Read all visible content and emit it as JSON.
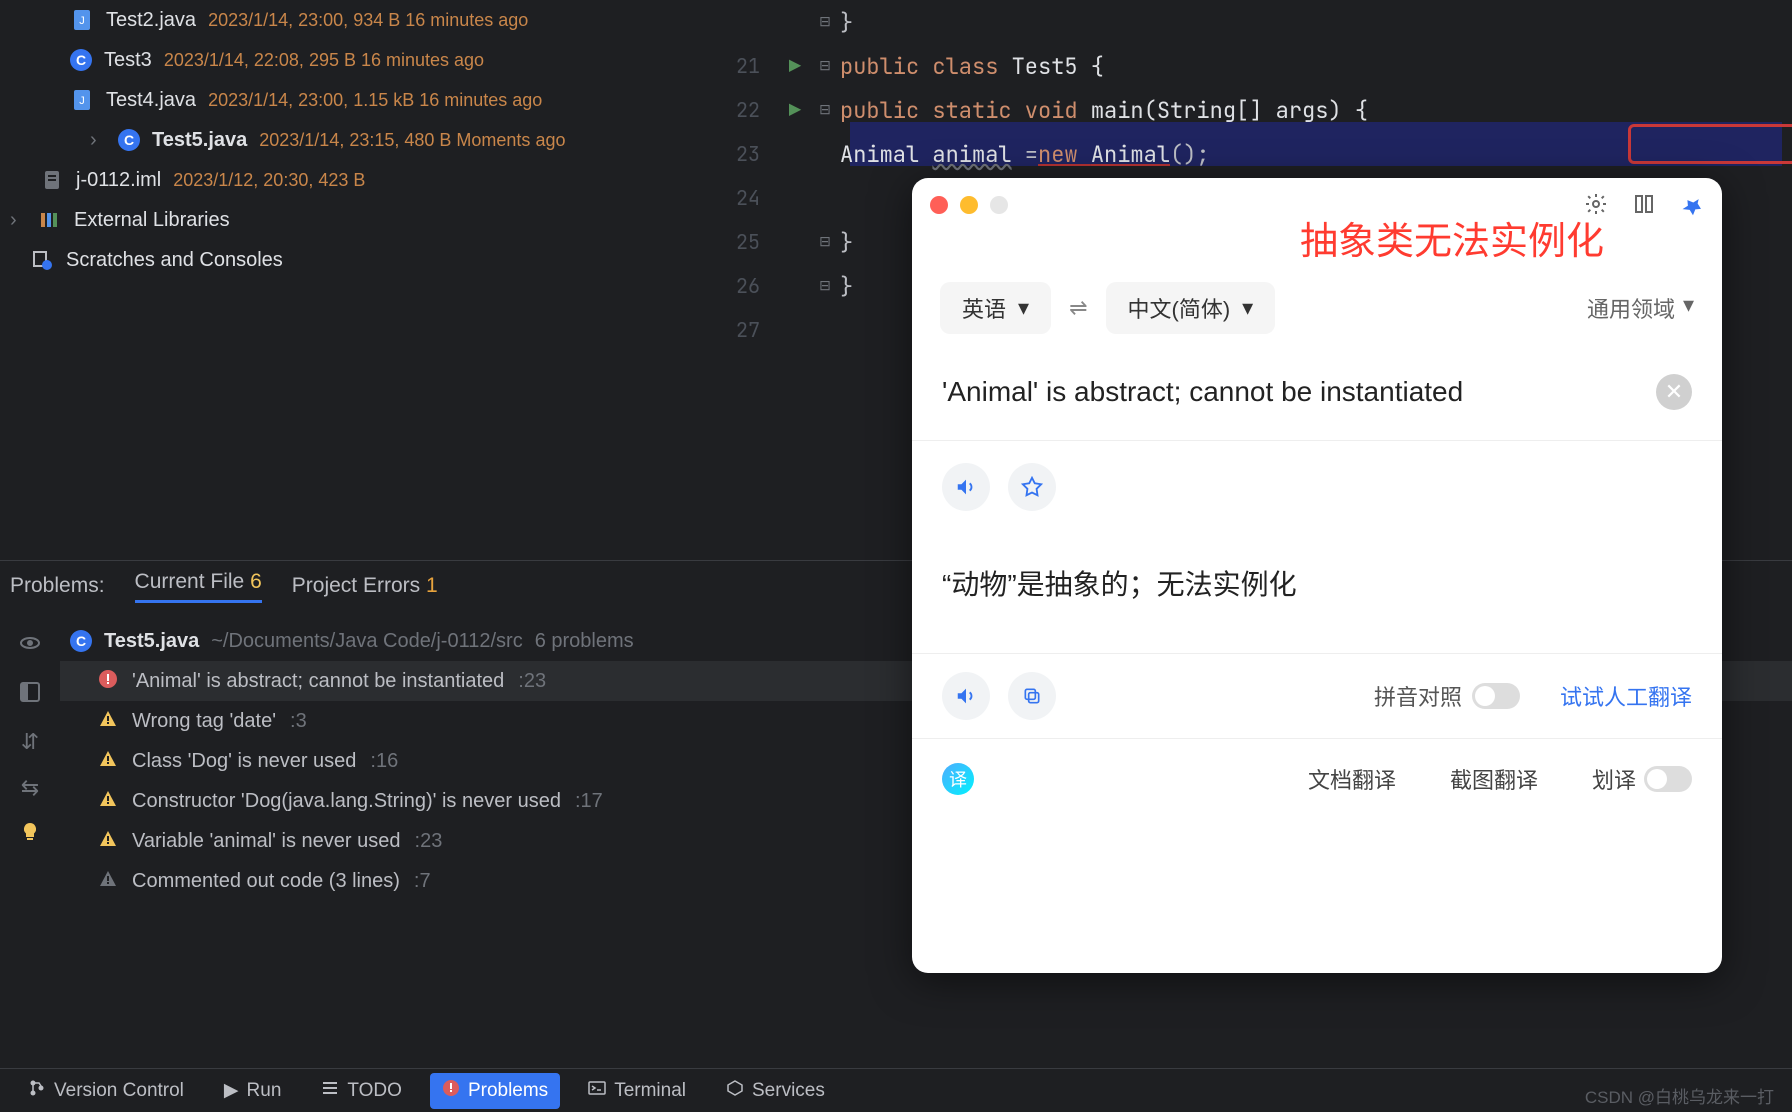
{
  "tree": {
    "files": [
      {
        "icon": "java",
        "name": "Test2.java",
        "meta": "2023/1/14, 23:00, 934 B 16 minutes ago"
      },
      {
        "icon": "class",
        "name": "Test3",
        "meta": "2023/1/14, 22:08, 295 B 16 minutes ago"
      },
      {
        "icon": "java",
        "name": "Test4.java",
        "meta": "2023/1/14, 23:00, 1.15 kB 16 minutes ago"
      },
      {
        "icon": "class",
        "name": "Test5.java",
        "meta": "2023/1/14, 23:15, 480 B Moments ago",
        "expandable": true
      },
      {
        "icon": "iml",
        "name": "j-0112.iml",
        "meta": "2023/1/12, 20:30, 423 B",
        "level": 1
      }
    ],
    "external_libs": "External Libraries",
    "scratches": "Scratches and Consoles"
  },
  "editor": {
    "lines": [
      {
        "num": "",
        "fold": "⊟",
        "tokens": [
          {
            "t": "}",
            "c": ""
          }
        ]
      },
      {
        "num": "21",
        "run": "▶",
        "fold": "⊟",
        "tokens": [
          {
            "t": "public class ",
            "c": "kw"
          },
          {
            "t": "Test5 {",
            "c": "typ"
          }
        ]
      },
      {
        "num": "22",
        "run": "▶",
        "fold": "⊟",
        "tokens": [
          {
            "t": "    public static void ",
            "c": "kw"
          },
          {
            "t": "main",
            "c": "typ"
          },
          {
            "t": "(String[] args) {",
            "c": "typ"
          }
        ]
      },
      {
        "num": "23",
        "fold": "",
        "tokens": [
          {
            "t": "        Animal ",
            "c": "typ"
          },
          {
            "t": "animal",
            "c": "var wiggle"
          },
          {
            "t": " =",
            "c": ""
          },
          {
            "t": "new ",
            "c": "kw underline-err"
          },
          {
            "t": "Animal",
            "c": "typ underline-err"
          },
          {
            "t": "();",
            "c": ""
          }
        ]
      },
      {
        "num": "24",
        "fold": "",
        "tokens": []
      },
      {
        "num": "25",
        "fold": "⊟",
        "tokens": [
          {
            "t": "    }",
            "c": ""
          }
        ]
      },
      {
        "num": "26",
        "fold": "⊟",
        "tokens": [
          {
            "t": "}",
            "c": ""
          }
        ]
      },
      {
        "num": "27",
        "fold": "",
        "tokens": []
      }
    ]
  },
  "cn_overlay": "抽象类无法实例化",
  "problems": {
    "label": "Problems:",
    "tabs": {
      "current": {
        "label": "Current File",
        "count": "6"
      },
      "project": {
        "label": "Project Errors",
        "count": "1"
      }
    },
    "header": {
      "file": "Test5.java",
      "path": "~/Documents/Java Code/j-0112/src",
      "count": "6 problems"
    },
    "items": [
      {
        "sev": "err",
        "text": "'Animal' is abstract; cannot be instantiated",
        "loc": ":23",
        "selected": true
      },
      {
        "sev": "warn",
        "text": "Wrong tag 'date'",
        "loc": ":3"
      },
      {
        "sev": "warn",
        "text": "Class 'Dog' is never used",
        "loc": ":16"
      },
      {
        "sev": "warn",
        "text": "Constructor 'Dog(java.lang.String)' is never used",
        "loc": ":17"
      },
      {
        "sev": "warn",
        "text": "Variable 'animal' is never used",
        "loc": ":23"
      },
      {
        "sev": "weak",
        "text": "Commented out code (3 lines)",
        "loc": ":7"
      }
    ]
  },
  "toolbar": {
    "items": [
      {
        "icon": "vc",
        "label": "Version Control"
      },
      {
        "icon": "run",
        "label": "Run"
      },
      {
        "icon": "todo",
        "label": "TODO"
      },
      {
        "icon": "problems",
        "label": "Problems",
        "active": true
      },
      {
        "icon": "terminal",
        "label": "Terminal"
      },
      {
        "icon": "services",
        "label": "Services"
      }
    ]
  },
  "translator": {
    "src_lang": "英语",
    "tgt_lang": "中文(简体)",
    "domain_label": "通用领域",
    "src_text": "'Animal' is abstract; cannot be instantiated",
    "trans_text": "“动物”是抽象的；无法实例化",
    "pinyin_label": "拼音对照",
    "try_human": "试试人工翻译",
    "doc_trans": "文档翻译",
    "shot_trans": "截图翻译",
    "hua_trans": "划译"
  },
  "watermark": "CSDN @白桃乌龙来一打"
}
